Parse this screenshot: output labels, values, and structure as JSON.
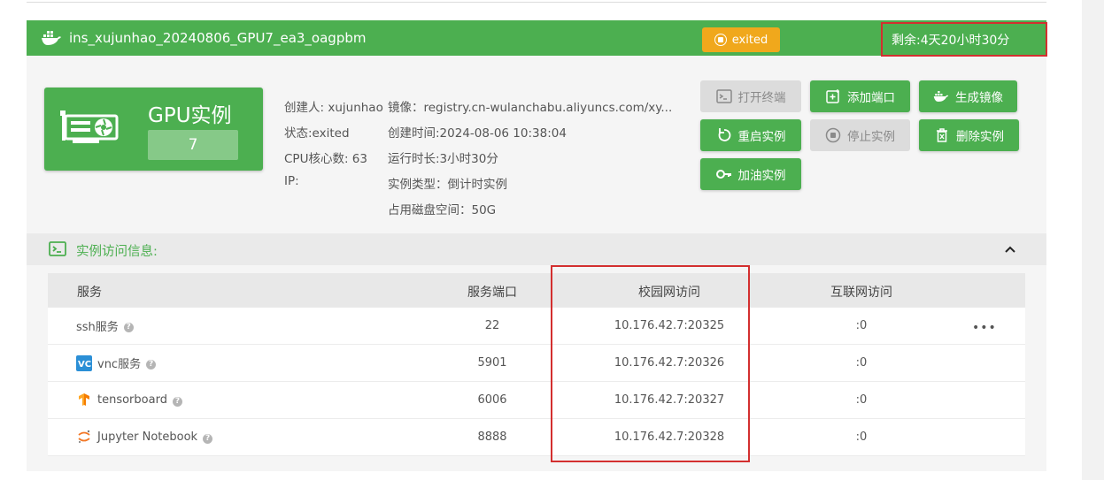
{
  "header": {
    "instance_name": "ins_xujunhao_20240806_GPU7_ea3_oagpbm",
    "status": "exited",
    "remaining": "剩余:4天20小时30分"
  },
  "gpu_card": {
    "title": "GPU实例",
    "count": "7"
  },
  "info": {
    "creator": "创建人: xujunhao",
    "state": "状态:exited",
    "cpu": "CPU核心数: 63",
    "ip": "IP:",
    "image": "镜像：registry.cn-wulanchabu.aliyuncs.com/xy...",
    "created": "创建时间:2024-08-06 10:38:04",
    "runtime": "运行时长:3小时30分",
    "type": "实例类型：倒计时实例",
    "disk": "占用磁盘空间：50G"
  },
  "actions": {
    "open_terminal": "打开终端",
    "add_port": "添加端口",
    "build_image": "生成镜像",
    "restart": "重启实例",
    "stop": "停止实例",
    "delete": "删除实例",
    "refuel": "加油实例"
  },
  "access": {
    "title": "实例访问信息:",
    "columns": [
      "服务",
      "服务端口",
      "校园网访问",
      "互联网访问"
    ],
    "rows": [
      {
        "service": "ssh服务",
        "port": "22",
        "campus": "10.176.42.7:20325",
        "internet": ":0",
        "icon": "none"
      },
      {
        "service": "vnc服务",
        "port": "5901",
        "campus": "10.176.42.7:20326",
        "internet": ":0",
        "icon": "vnc-icon"
      },
      {
        "service": "tensorboard",
        "port": "6006",
        "campus": "10.176.42.7:20327",
        "internet": ":0",
        "icon": "tensorflow-icon"
      },
      {
        "service": "Jupyter Notebook",
        "port": "8888",
        "campus": "10.176.42.7:20328",
        "internet": ":0",
        "icon": "jupyter-icon"
      }
    ],
    "more": "•••"
  },
  "colors": {
    "primary": "#4caf50",
    "warning": "#f0a81c",
    "highlight": "#d32f2f"
  }
}
